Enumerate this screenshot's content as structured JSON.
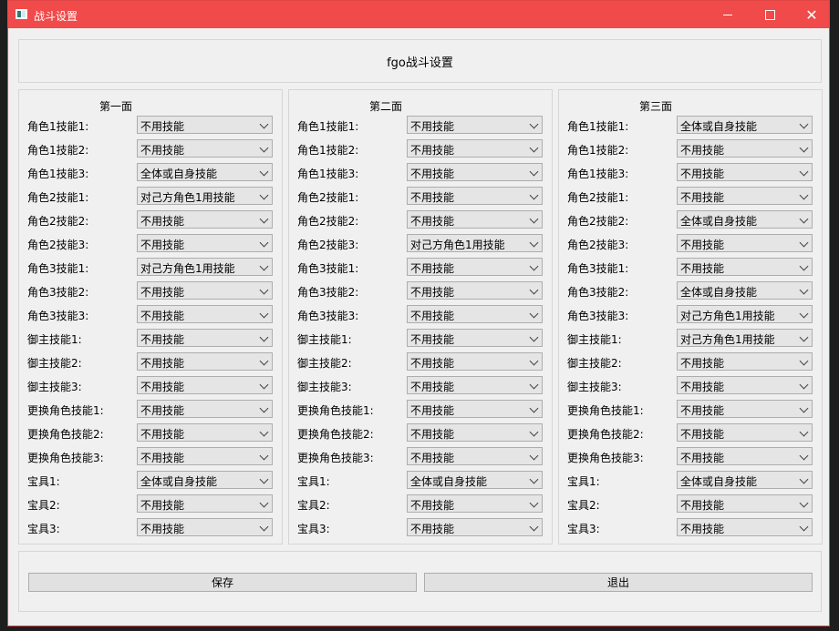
{
  "window": {
    "title": "战斗设置"
  },
  "header": {
    "title": "fgo战斗设置"
  },
  "groups": [
    {
      "title": "第一面",
      "rows": [
        {
          "label": "角色1技能1:",
          "value": "不用技能"
        },
        {
          "label": "角色1技能2:",
          "value": "不用技能"
        },
        {
          "label": "角色1技能3:",
          "value": "全体或自身技能"
        },
        {
          "label": "角色2技能1:",
          "value": "对己方角色1用技能"
        },
        {
          "label": "角色2技能2:",
          "value": "不用技能"
        },
        {
          "label": "角色2技能3:",
          "value": "不用技能"
        },
        {
          "label": "角色3技能1:",
          "value": "对己方角色1用技能"
        },
        {
          "label": "角色3技能2:",
          "value": "不用技能"
        },
        {
          "label": "角色3技能3:",
          "value": "不用技能"
        },
        {
          "label": "御主技能1:",
          "value": "不用技能"
        },
        {
          "label": "御主技能2:",
          "value": "不用技能"
        },
        {
          "label": "御主技能3:",
          "value": "不用技能"
        },
        {
          "label": "更换角色技能1:",
          "value": "不用技能"
        },
        {
          "label": "更换角色技能2:",
          "value": "不用技能"
        },
        {
          "label": "更换角色技能3:",
          "value": "不用技能"
        },
        {
          "label": "宝具1:",
          "value": "全体或自身技能"
        },
        {
          "label": "宝具2:",
          "value": "不用技能"
        },
        {
          "label": "宝具3:",
          "value": "不用技能"
        }
      ]
    },
    {
      "title": "第二面",
      "rows": [
        {
          "label": "角色1技能1:",
          "value": "不用技能"
        },
        {
          "label": "角色1技能2:",
          "value": "不用技能"
        },
        {
          "label": "角色1技能3:",
          "value": "不用技能"
        },
        {
          "label": "角色2技能1:",
          "value": "不用技能"
        },
        {
          "label": "角色2技能2:",
          "value": "不用技能"
        },
        {
          "label": "角色2技能3:",
          "value": "对己方角色1用技能"
        },
        {
          "label": "角色3技能1:",
          "value": "不用技能"
        },
        {
          "label": "角色3技能2:",
          "value": "不用技能"
        },
        {
          "label": "角色3技能3:",
          "value": "不用技能"
        },
        {
          "label": "御主技能1:",
          "value": "不用技能"
        },
        {
          "label": "御主技能2:",
          "value": "不用技能"
        },
        {
          "label": "御主技能3:",
          "value": "不用技能"
        },
        {
          "label": "更换角色技能1:",
          "value": "不用技能"
        },
        {
          "label": "更换角色技能2:",
          "value": "不用技能"
        },
        {
          "label": "更换角色技能3:",
          "value": "不用技能"
        },
        {
          "label": "宝具1:",
          "value": "全体或自身技能"
        },
        {
          "label": "宝具2:",
          "value": "不用技能"
        },
        {
          "label": "宝具3:",
          "value": "不用技能"
        }
      ]
    },
    {
      "title": "第三面",
      "rows": [
        {
          "label": "角色1技能1:",
          "value": "全体或自身技能"
        },
        {
          "label": "角色1技能2:",
          "value": "不用技能"
        },
        {
          "label": "角色1技能3:",
          "value": "不用技能"
        },
        {
          "label": "角色2技能1:",
          "value": "不用技能"
        },
        {
          "label": "角色2技能2:",
          "value": "全体或自身技能"
        },
        {
          "label": "角色2技能3:",
          "value": "不用技能"
        },
        {
          "label": "角色3技能1:",
          "value": "不用技能"
        },
        {
          "label": "角色3技能2:",
          "value": "全体或自身技能"
        },
        {
          "label": "角色3技能3:",
          "value": "对己方角色1用技能"
        },
        {
          "label": "御主技能1:",
          "value": "对己方角色1用技能"
        },
        {
          "label": "御主技能2:",
          "value": "不用技能"
        },
        {
          "label": "御主技能3:",
          "value": "不用技能"
        },
        {
          "label": "更换角色技能1:",
          "value": "不用技能"
        },
        {
          "label": "更换角色技能2:",
          "value": "不用技能"
        },
        {
          "label": "更换角色技能3:",
          "value": "不用技能"
        },
        {
          "label": "宝具1:",
          "value": "全体或自身技能"
        },
        {
          "label": "宝具2:",
          "value": "不用技能"
        },
        {
          "label": "宝具3:",
          "value": "不用技能"
        }
      ]
    }
  ],
  "footer": {
    "save_label": "保存",
    "exit_label": "退出"
  },
  "colors": {
    "titlebar": "#f04a4a",
    "window_bg": "#f0f0f0"
  }
}
